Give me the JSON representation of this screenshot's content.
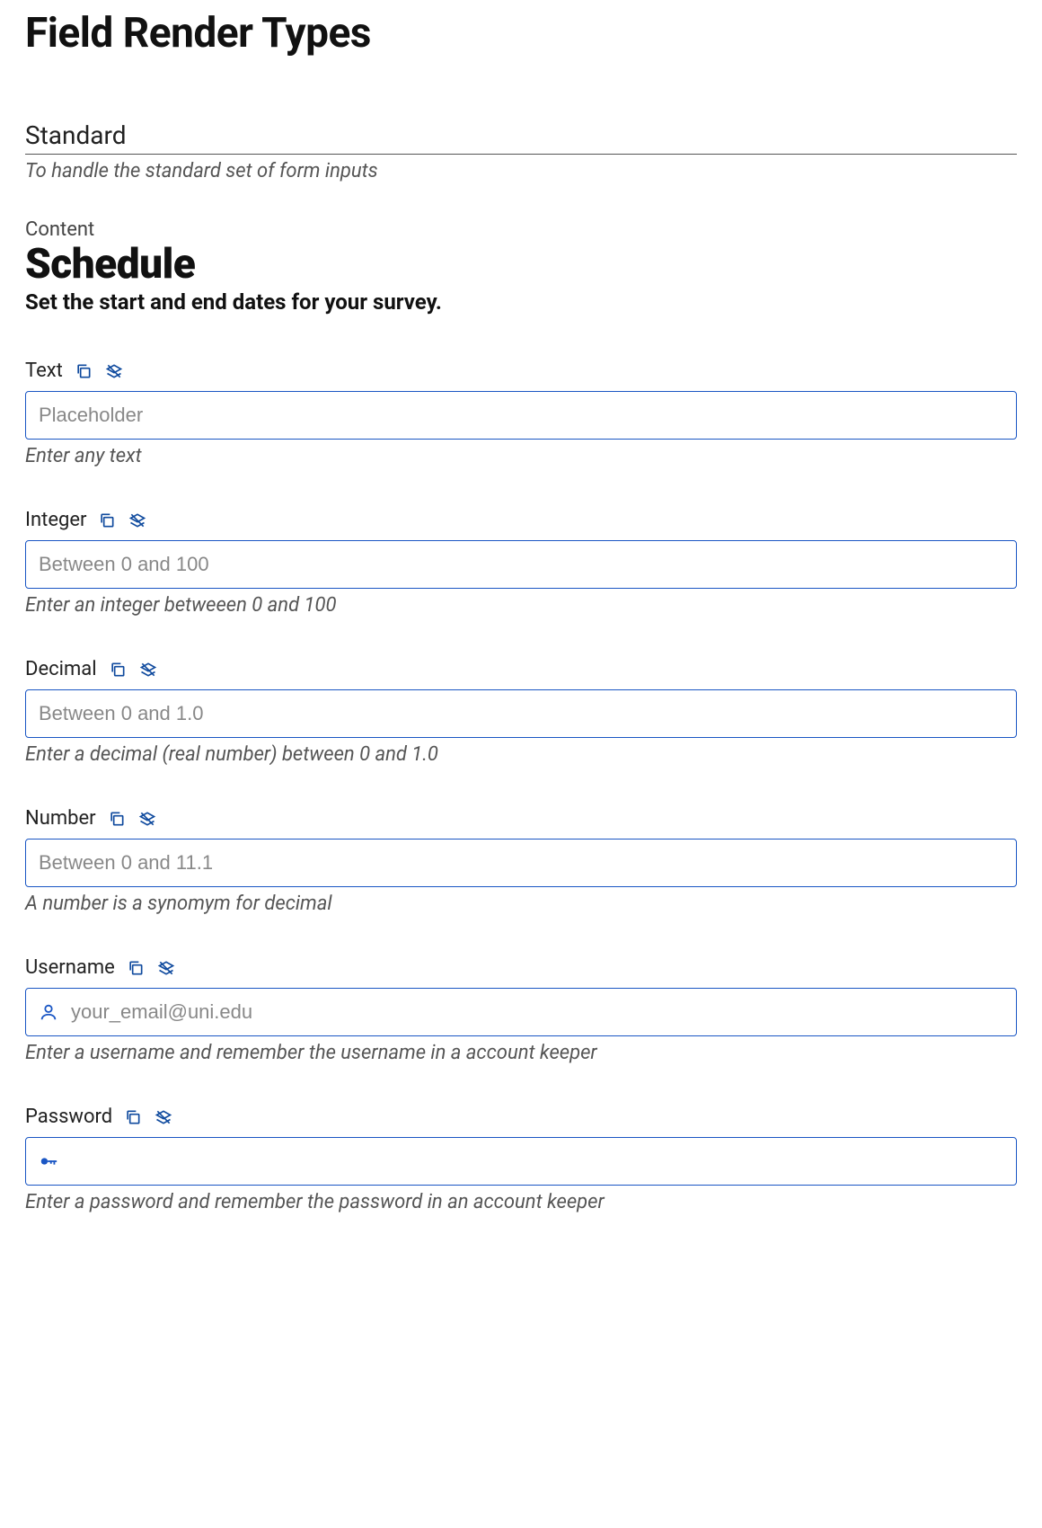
{
  "page_title": "Field Render Types",
  "section": {
    "title": "Standard",
    "subtitle": "To handle the standard set of form inputs"
  },
  "content": {
    "label": "Content",
    "heading": "Schedule",
    "description": "Set the start and end dates for your survey."
  },
  "fields": {
    "text": {
      "label": "Text",
      "placeholder": "Placeholder",
      "help": "Enter any text"
    },
    "integer": {
      "label": "Integer",
      "placeholder": "Between 0 and 100",
      "help": "Enter an integer betweeen 0 and 100"
    },
    "decimal": {
      "label": "Decimal",
      "placeholder": "Between 0 and 1.0",
      "help": "Enter a decimal (real number) between 0 and 1.0"
    },
    "number": {
      "label": "Number",
      "placeholder": "Between 0 and 11.1",
      "help": "A number is a synomym for decimal"
    },
    "username": {
      "label": "Username",
      "placeholder": "your_email@uni.edu",
      "help": "Enter a username and remember the username in a account keeper"
    },
    "password": {
      "label": "Password",
      "placeholder": "",
      "help": "Enter a password and remember the password in an account keeper"
    }
  }
}
